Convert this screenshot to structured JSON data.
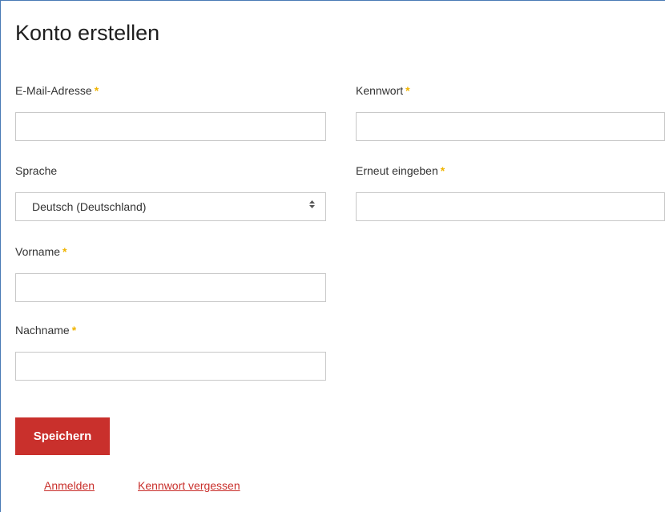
{
  "form": {
    "title": "Konto erstellen",
    "required_marker": "*",
    "email": {
      "label": "E-Mail-Adresse",
      "value": "",
      "placeholder": ""
    },
    "password": {
      "label": "Kennwort",
      "value": "",
      "placeholder": ""
    },
    "language": {
      "label": "Sprache",
      "selected": "Deutsch (Deutschland)"
    },
    "password_repeat": {
      "label": "Erneut eingeben",
      "value": "",
      "placeholder": ""
    },
    "first_name": {
      "label": "Vorname",
      "value": "",
      "placeholder": ""
    },
    "last_name": {
      "label": "Nachname",
      "value": "",
      "placeholder": ""
    },
    "save_label": "Speichern",
    "links": {
      "login": "Anmelden",
      "forgot_password": "Kennwort vergessen"
    }
  },
  "colors": {
    "accent": "#c9302c",
    "required": "#f0b400",
    "frame_border": "#4a7ab5"
  },
  "icons": {
    "select_arrows": "sort-arrows-icon"
  }
}
